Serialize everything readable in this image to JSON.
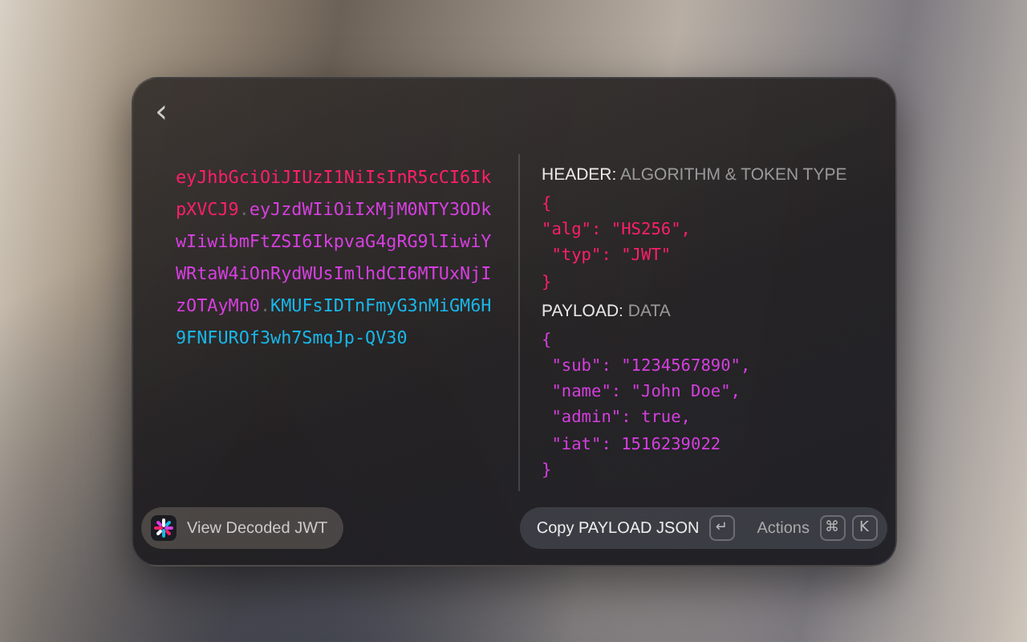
{
  "window": {
    "back_button": "‹"
  },
  "token": {
    "parts": [
      {
        "text": "eyJhbGciOiJIUzI1NiIsInR5cCI6IkpXVCJ9",
        "color": "#ff1f6b"
      },
      {
        "text": "eyJzdWIiOiIxMjM0NTY3ODkwIiwibmFtZSI6IkpvaG4gRG9lIiwiYWRtaW4iOnRydWUsImlhdCI6MTUxNjIzOTAyMn0",
        "color": "#d63fe0"
      },
      {
        "text": "KMUFsIDTnFmyG3nMiGM6H9FNFUROf3wh7SmqJp-QV30",
        "color": "#1ab6e8"
      }
    ],
    "separator": "."
  },
  "sections": [
    {
      "label": "HEADER:",
      "caption": "ALGORITHM & TOKEN TYPE",
      "color": "#ff1f6b",
      "lines": [
        "{",
        "\"alg\": \"HS256\",",
        " \"typ\": \"JWT\"",
        "}"
      ]
    },
    {
      "label": "PAYLOAD:",
      "caption": "DATA",
      "color": "#d63fe0",
      "lines": [
        "{",
        " \"sub\": \"1234567890\",",
        " \"name\": \"John Doe\",",
        " \"admin\": true,",
        " \"iat\": 1516239022",
        "}"
      ]
    }
  ],
  "footer": {
    "left_button": "View Decoded JWT",
    "primary_action": "Copy PAYLOAD JSON",
    "primary_key": "↵",
    "actions_label": "Actions",
    "action_keys": [
      "⌘",
      "K"
    ]
  }
}
